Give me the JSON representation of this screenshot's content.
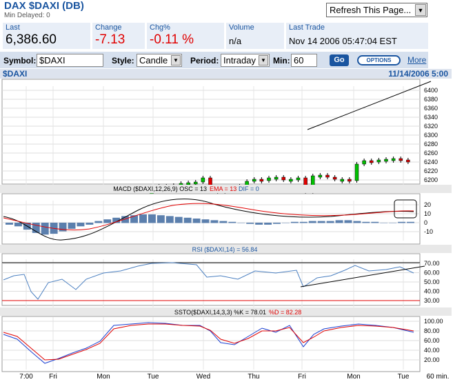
{
  "header": {
    "title": "DAX   $DAXI (DB)",
    "subtitle": "Min Delayed: 0",
    "refresh_label": "Refresh This Page..."
  },
  "quote": {
    "last_label": "Last",
    "last_value": "6,386.60",
    "change_label": "Change",
    "change_value": "-7.13",
    "chgpct_label": "Chg%",
    "chgpct_value": "-0.11 %",
    "volume_label": "Volume",
    "volume_value": "n/a",
    "lasttrade_label": "Last Trade",
    "lasttrade_value": "Nov 14 2006 05:47:04 EST"
  },
  "toolbar": {
    "symbol_label": "Symbol:",
    "symbol_value": "$DAXI",
    "style_label": "Style:",
    "style_value": "Candle",
    "period_label": "Period:",
    "period_value": "Intraday",
    "min_label": "Min:",
    "min_value": "60",
    "go_label": "Go",
    "options_label": "OPTIONS",
    "more_label": "More"
  },
  "chart": {
    "symbol": "$DAXI",
    "date": "11/14/2006 5:00",
    "macd_label": "MACD ($DAXI,12,26,9) OSC = 13",
    "macd_ema": "EMA = 13",
    "macd_dif": "DIF = 0",
    "rsi_label": "RSI ($DAXI,14) = 56.84",
    "ssto_label": "SSTO($DAXI,14,3,3) %K = 78.01",
    "ssto_d": "%D = 82.28",
    "price_ticks": [
      "6400",
      "6380",
      "6360",
      "6340",
      "6320",
      "6300",
      "6280",
      "6260",
      "6240",
      "6220",
      "6200"
    ],
    "macd_ticks": [
      "20",
      "10",
      "0",
      "-10"
    ],
    "rsi_ticks": [
      "70.00",
      "60.00",
      "50.00",
      "40.00",
      "30.00"
    ],
    "ssto_ticks": [
      "100.00",
      "80.00",
      "60.00",
      "40.00",
      "20.00"
    ],
    "x_labels": [
      "7:00",
      "Fri",
      "Mon",
      "Tue",
      "Wed",
      "Thu",
      "Fri",
      "Mon",
      "Tue",
      "60 min."
    ]
  },
  "colors": {
    "up": "#00c000",
    "down": "#e00000",
    "accent": "#1a55a0"
  }
}
